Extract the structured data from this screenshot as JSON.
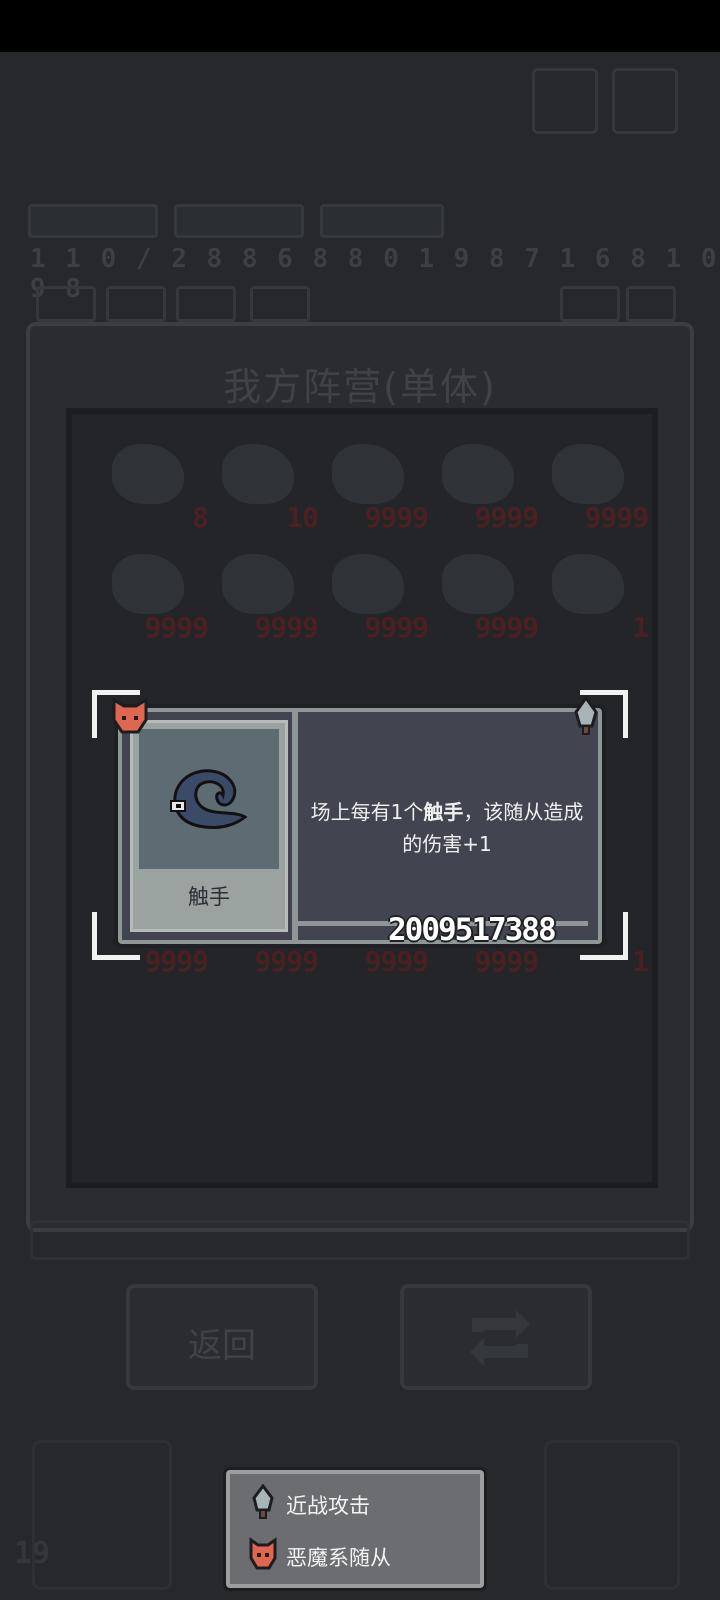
{
  "status_bar": {},
  "background": {
    "panel_title": "我方阵营(单体)",
    "stat_numbers": "1 1 0 / 2 8 8 6 8 8 0 1 9 8 7 1 6 8 1 0 9 8",
    "back_label": "返回",
    "level": "19",
    "grid_values": [
      "8",
      "10",
      "9999",
      "9999",
      "9999",
      "9999",
      "9999",
      "9999",
      "9999",
      "1",
      "9999",
      "9999",
      "9999",
      "9999",
      "1"
    ]
  },
  "card": {
    "name": "触手",
    "description_prefix": "场上每有1个",
    "description_keyword": "触手",
    "description_suffix": "，该随从造成的伤害+1",
    "id_number": "2009517388",
    "left_badge_icon": "demon-fox-icon",
    "right_badge_icon": "sword-icon",
    "portrait_icon": "tentacle-icon"
  },
  "legend": {
    "melee_label": "近战攻击",
    "demon_label": "恶魔系随从",
    "melee_icon": "sword-icon",
    "demon_icon": "demon-fox-icon"
  },
  "colors": {
    "overlay": "#26282b",
    "card_bg": "#42444f",
    "card_border": "#8e9795",
    "demon_badge": "#e0674f",
    "number_red_dim": "#4a2022"
  }
}
